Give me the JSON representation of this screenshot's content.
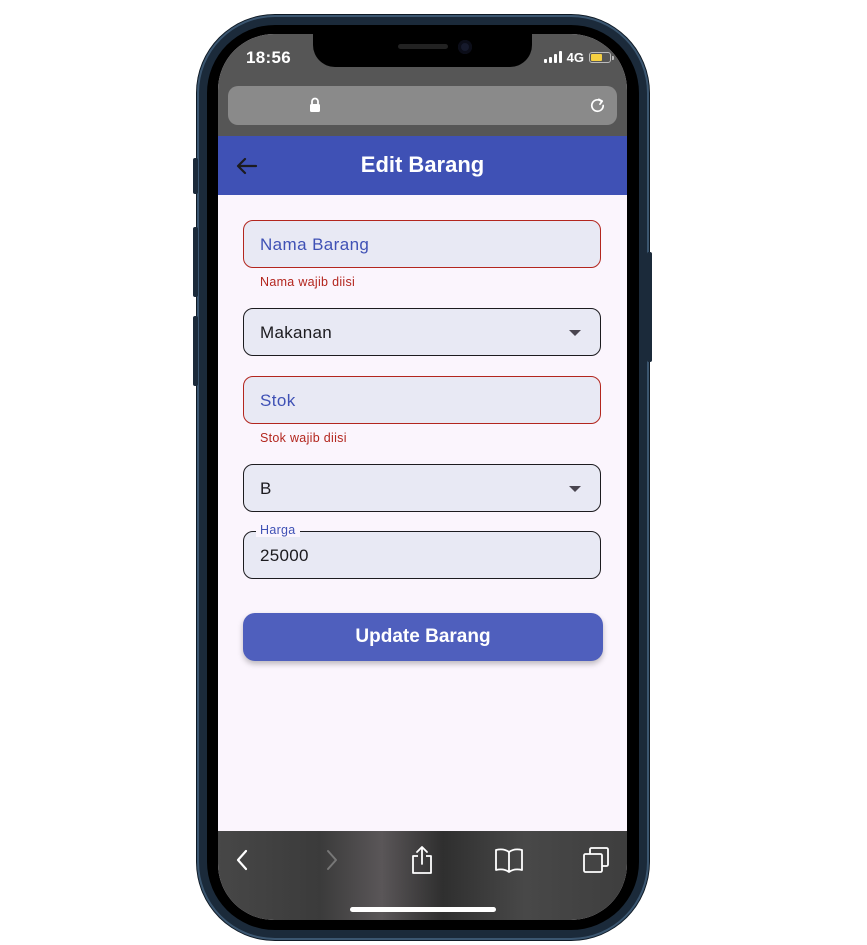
{
  "status_bar": {
    "time": "18:56",
    "network": "4G"
  },
  "browser": {
    "url_text": ""
  },
  "app_bar": {
    "title": "Edit Barang"
  },
  "form": {
    "nama_field": {
      "placeholder": "Nama Barang",
      "error": "Nama wajib diisi"
    },
    "kategori_dropdown": {
      "selected": "Makanan"
    },
    "stok_field": {
      "placeholder": "Stok",
      "error": "Stok wajib diisi"
    },
    "grade_dropdown": {
      "selected": "B"
    },
    "harga_field": {
      "label": "Harga",
      "value": "25000"
    },
    "submit_label": "Update Barang"
  },
  "icons": {
    "back": "arrow-left-icon",
    "lock": "lock-icon",
    "reload": "reload-icon",
    "toolbar": [
      "chevron-left-icon",
      "chevron-right-icon",
      "share-icon",
      "bookmarks-icon",
      "tabs-icon"
    ]
  },
  "colors": {
    "primary": "#3f51b5",
    "error": "#b3261e",
    "field_fill": "#e8e9f4",
    "background": "#fbf5fd",
    "button": "#4f5fbd"
  }
}
